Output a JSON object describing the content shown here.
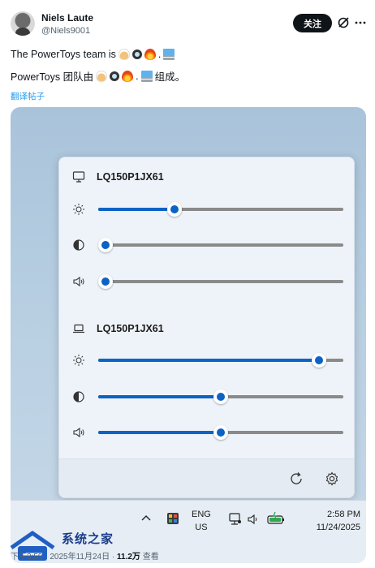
{
  "author": {
    "name": "Niels Laute",
    "handle": "@Niels9001",
    "follow_label": "关注"
  },
  "tweet": {
    "line1_prefix": "The PowerToys team is",
    "line1_suffix": ".",
    "line2_prefix": "PowerToys 团队由",
    "line2_sep": ".",
    "line2_suffix": "组成。",
    "translate_label": "翻译帖子"
  },
  "flyout": {
    "monitors": [
      {
        "name": "LQ150P1JX61",
        "icon": "monitor-icon",
        "sliders": [
          {
            "id": "brightness",
            "icon": "sun-icon",
            "value": 0.31
          },
          {
            "id": "contrast",
            "icon": "contrast-icon",
            "value": 0.03
          },
          {
            "id": "volume",
            "icon": "speaker-icon",
            "value": 0.03
          }
        ]
      },
      {
        "name": "LQ150P1JX61",
        "icon": "laptop-icon",
        "sliders": [
          {
            "id": "brightness",
            "icon": "sun-icon",
            "value": 0.9
          },
          {
            "id": "contrast",
            "icon": "contrast-icon",
            "value": 0.5
          },
          {
            "id": "volume",
            "icon": "speaker-icon",
            "value": 0.5
          }
        ]
      }
    ]
  },
  "taskbar": {
    "lang_top": "ENG",
    "lang_bottom": "US",
    "time": "2:58 PM",
    "date": "11/24/2025"
  },
  "footer": {
    "post_time": "下午3:59 · 2025年11月24日",
    "views_count": "11.2万",
    "views_label": "查看"
  },
  "watermark": {
    "text": "系统之家"
  },
  "colors": {
    "accent": "#0b63c5",
    "link": "#1d9bf0",
    "follow_bg": "#0f1419"
  }
}
